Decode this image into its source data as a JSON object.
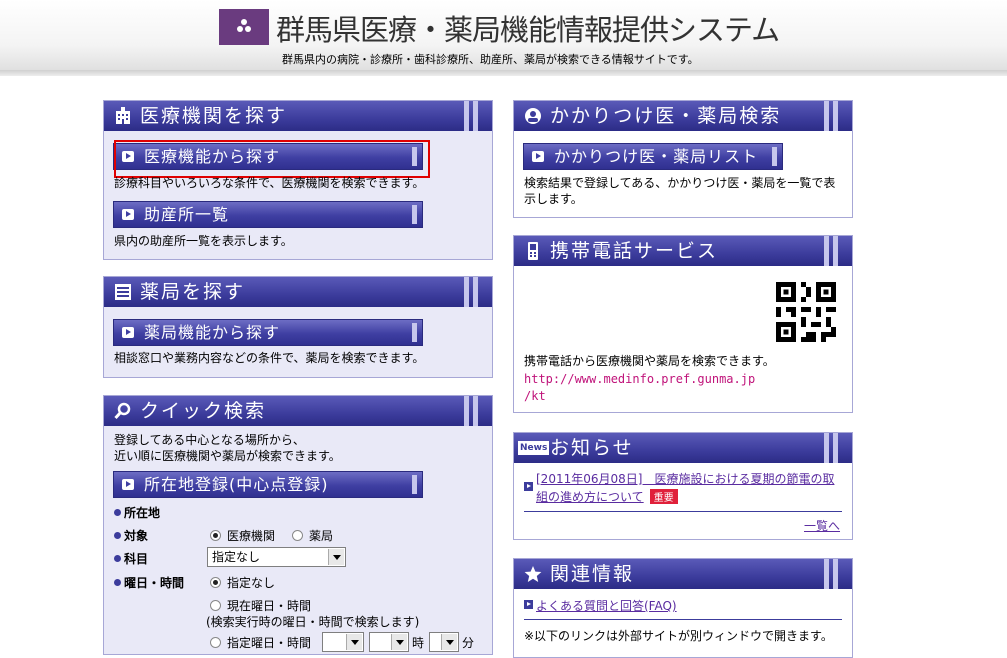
{
  "header": {
    "title": "群馬県医療・薬局機能情報提供システム",
    "subtitle": "群馬県内の病院・診療所・歯科診療所、助産所、薬局が検索できる情報サイトです。"
  },
  "medical": {
    "title": "医療機関を探す",
    "search_button": "医療機能から探す",
    "search_desc": "診療科目やいろいろな条件で、医療機関を検索できます。",
    "midwife_button": "助産所一覧",
    "midwife_desc": "県内の助産所一覧を表示します。"
  },
  "pharmacy": {
    "title": "薬局を探す",
    "search_button": "薬局機能から探す",
    "search_desc": "相談窓口や業務内容などの条件で、薬局を検索できます。"
  },
  "quick": {
    "title": "クイック検索",
    "desc_line1": "登録してある中心となる場所から、",
    "desc_line2": "近い順に医療機関や薬局が検索できます。",
    "location_button": "所在地登録(中心点登録)",
    "address_label": "所在地",
    "target_label": "対象",
    "target_options": [
      "医療機関",
      "薬局"
    ],
    "target_selected": "医療機関",
    "dept_label": "科目",
    "dept_value": "指定なし",
    "time_label": "曜日・時間",
    "time_option_none": "指定なし",
    "time_option_now": "現在曜日・時間",
    "time_option_now_note": "(検索実行時の曜日・時間で検索します)",
    "time_option_specify": "指定曜日・時間",
    "hour_suffix": "時",
    "minute_suffix": "分"
  },
  "kakaritsuke": {
    "title": "かかりつけ医・薬局検索",
    "button": "かかりつけ医・薬局リスト",
    "desc_line1": "検索結果で登録してある、かかりつけ医・薬局を一覧で表",
    "desc_line2": "示します。"
  },
  "mobile": {
    "title": "携帯電話サービス",
    "desc": "携帯電話から医療機関や薬局を検索できます。",
    "url_line1": "http://www.medinfo.pref.gunma.jp",
    "url_line2": "/kt"
  },
  "news": {
    "title": "お知らせ",
    "icon_label": "News",
    "item_line1": "[2011年06月08日]　医療施設における夏期の節電の取",
    "item_line2": "組の進め方について",
    "badge": "重要",
    "more_link": "一覧へ"
  },
  "related": {
    "title": "関連情報",
    "faq_link": "よくある質問と回答(FAQ)",
    "external_note": "※以下のリンクは外部サイトが別ウィンドウで開きます。"
  },
  "colors": {
    "panel_header": "#3c3c9c",
    "panel_bg": "#e9e9f7",
    "highlight_box": "#e00000",
    "pink_link": "#c0137a"
  }
}
